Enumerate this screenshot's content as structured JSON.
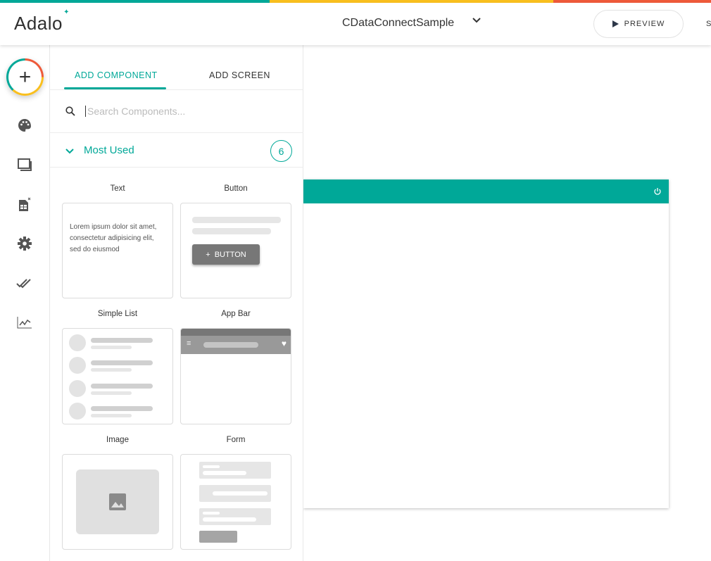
{
  "brand": {
    "logo": "Adalo",
    "colors": {
      "teal": "#00a898",
      "yellow": "#f9bf1e",
      "red": "#ee5a3a"
    }
  },
  "header": {
    "app_name": "CDataConnectSample",
    "preview_label": "PREVIEW",
    "cut_label": "S"
  },
  "rail": {
    "icons": [
      "add-icon",
      "palette-icon",
      "screens-icon",
      "database-icon",
      "settings-icon",
      "publish-icon",
      "analytics-icon"
    ]
  },
  "panel": {
    "tabs": [
      {
        "label": "ADD COMPONENT",
        "active": true
      },
      {
        "label": "ADD SCREEN",
        "active": false
      }
    ],
    "search": {
      "placeholder": "Search Components...",
      "value": ""
    },
    "section": {
      "label": "Most Used",
      "count": "6"
    },
    "components": [
      {
        "label": "Text",
        "preview_text": "Lorem ipsum dolor sit amet, consectetur adipisicing elit, sed do eiusmod"
      },
      {
        "label": "Button",
        "preview_text": "BUTTON"
      },
      {
        "label": "Simple List"
      },
      {
        "label": "App Bar"
      },
      {
        "label": "Image"
      },
      {
        "label": "Form"
      }
    ]
  }
}
